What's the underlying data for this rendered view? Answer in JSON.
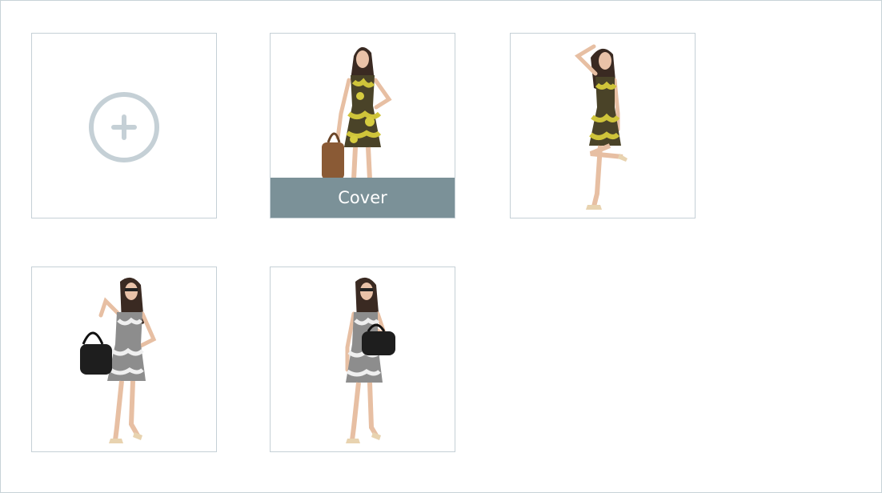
{
  "gallery": {
    "add_tile": {
      "icon": "plus-circle-icon"
    },
    "images": [
      {
        "subject": "model-yellow-floral-dress-handbag",
        "is_cover": true,
        "cover_label": "Cover"
      },
      {
        "subject": "model-yellow-floral-dress-raised-leg",
        "is_cover": false
      },
      {
        "subject": "model-black-white-dress-shoulder-bag",
        "is_cover": false
      },
      {
        "subject": "model-black-white-dress-sunglasses-bag",
        "is_cover": false
      }
    ]
  },
  "colors": {
    "border": "#c5d0d6",
    "cover_bar": "#7b9198",
    "add_icon": "#c5d0d6",
    "yellow_dress": "#c8c23a",
    "dark_floral": "#3e3a26",
    "bw_dress": "#8a8a8a"
  }
}
